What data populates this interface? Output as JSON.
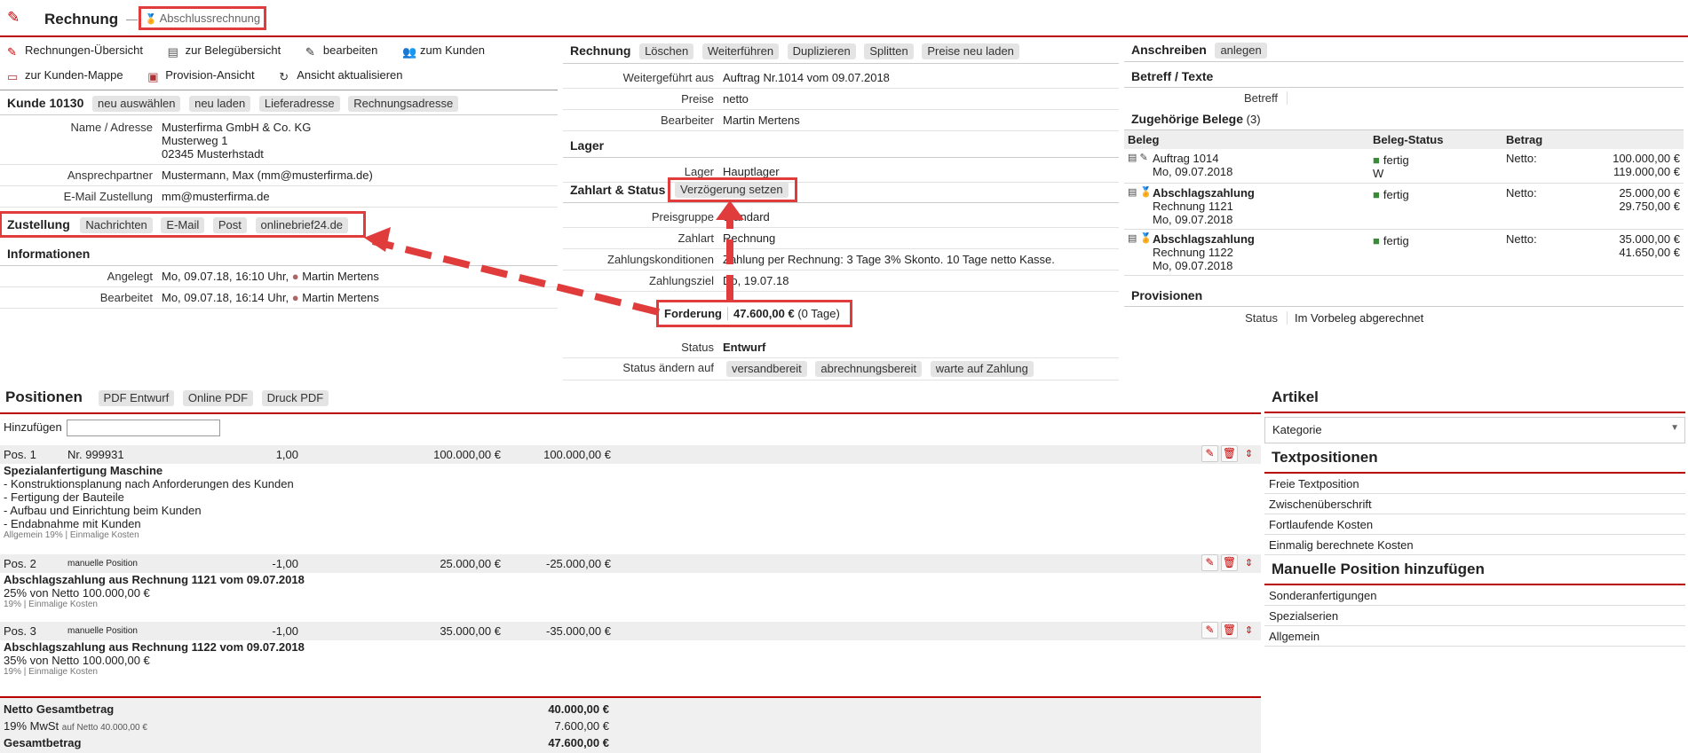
{
  "header": {
    "title": "Rechnung",
    "separator": "—",
    "badge": "Abschlussrechnung"
  },
  "toolbar": {
    "row1": [
      "Rechnungen-Übersicht",
      "zur Belegübersicht",
      "bearbeiten",
      "zum Kunden"
    ],
    "row2": [
      "zur Kunden-Mappe",
      "Provision-Ansicht",
      "Ansicht aktualisieren"
    ]
  },
  "customer": {
    "title": "Kunde 10130",
    "buttons": [
      "neu auswählen",
      "neu laden",
      "Lieferadresse",
      "Rechnungsadresse"
    ],
    "name_label": "Name / Adresse",
    "address": [
      "Musterfirma GmbH & Co. KG",
      "Musterweg 1",
      "02345 Musterhstadt"
    ],
    "contact_label": "Ansprechpartner",
    "contact": "Mustermann, Max (mm@musterfirma.de)",
    "email_label": "E-Mail Zustellung",
    "email": "mm@musterfirma.de"
  },
  "delivery": {
    "title": "Zustellung",
    "buttons": [
      "Nachrichten",
      "E-Mail",
      "Post",
      "onlinebrief24.de"
    ]
  },
  "info": {
    "title": "Informationen",
    "created_label": "Angelegt",
    "created": "Mo, 09.07.18, 16:10 Uhr,",
    "created_by": "Martin Mertens",
    "edited_label": "Bearbeitet",
    "edited": "Mo, 09.07.18, 16:14 Uhr,",
    "edited_by": "Martin Mertens"
  },
  "invoice": {
    "title": "Rechnung",
    "buttons": [
      "Löschen",
      "Weiterführen",
      "Duplizieren",
      "Splitten",
      "Preise neu laden"
    ],
    "from_label": "Weitergeführt aus",
    "from": "Auftrag Nr.1014 vom 09.07.2018",
    "prices_label": "Preise",
    "prices": "netto",
    "editor_label": "Bearbeiter",
    "editor": "Martin Mertens"
  },
  "stock": {
    "title": "Lager",
    "label": "Lager",
    "value": "Hauptlager"
  },
  "payment": {
    "title": "Zahlart & Status",
    "delay_button": "Verzögerung setzen",
    "group_label": "Preisgruppe",
    "group": "Standard",
    "method_label": "Zahlart",
    "method": "Rechnung",
    "terms_label": "Zahlungskonditionen",
    "terms": "Zahlung per Rechnung: 3 Tage 3% Skonto. 10 Tage netto Kasse.",
    "due_label": "Zahlungsziel",
    "due": "Do, 19.07.18",
    "claim_label": "Forderung",
    "claim_amount": "47.600,00 €",
    "claim_days": "(0 Tage)",
    "status_label": "Status",
    "status": "Entwurf",
    "change_label": "Status ändern auf",
    "change_buttons": [
      "versandbereit",
      "abrechnungsbereit",
      "warte auf Zahlung"
    ]
  },
  "letter": {
    "title": "Anschreiben",
    "button": "anlegen",
    "subject_title": "Betreff / Texte",
    "subject_value": "Betreff"
  },
  "related": {
    "title": "Zugehörige Belege",
    "count": "(3)",
    "headers": [
      "Beleg",
      "Beleg-Status",
      "Betrag"
    ],
    "rows": [
      {
        "line1": "Auftrag 1014",
        "line2": "Mo, 09.07.2018",
        "line3": "",
        "status": "fertig",
        "status2": "W",
        "netto": "Netto:",
        "v1": "100.000,00 €",
        "v2": "119.000,00 €"
      },
      {
        "line1": "Abschlagszahlung",
        "line2": "Rechnung 1121",
        "line3": "Mo, 09.07.2018",
        "status": "fertig",
        "status2": "",
        "netto": "Netto:",
        "v1": "25.000,00 €",
        "v2": "29.750,00 €"
      },
      {
        "line1": "Abschlagszahlung",
        "line2": "Rechnung 1122",
        "line3": "Mo, 09.07.2018",
        "status": "fertig",
        "status2": "",
        "netto": "Netto:",
        "v1": "35.000,00 €",
        "v2": "41.650,00 €"
      }
    ]
  },
  "commission": {
    "title": "Provisionen",
    "status_label": "Status",
    "status": "Im Vorbeleg abgerechnet"
  },
  "positions": {
    "title": "Positionen",
    "buttons": [
      "PDF Entwurf",
      "Online PDF",
      "Druck PDF"
    ],
    "add_label": "Hinzufügen",
    "items": [
      {
        "pos": "Pos. 1",
        "nr": "Nr. 999931",
        "qty": "1,00",
        "price": "100.000,00 €",
        "total": "100.000,00 €",
        "title": "Spezialanfertigung Maschine",
        "lines": [
          "- Konstruktionsplanung nach Anforderungen des Kunden",
          "- Fertigung der Bauteile",
          "- Aufbau und Einrichtung beim Kunden",
          "- Endabnahme mit Kunden"
        ],
        "meta": "Allgemein 19% | Einmalige Kosten"
      },
      {
        "pos": "Pos. 2",
        "nr": "manuelle Position",
        "qty": "-1,00",
        "price": "25.000,00 €",
        "total": "-25.000,00 €",
        "title": "Abschlagszahlung aus Rechnung 1121 vom 09.07.2018",
        "lines": [
          "25% von Netto 100.000,00 €"
        ],
        "meta": "19% | Einmalige Kosten"
      },
      {
        "pos": "Pos. 3",
        "nr": "manuelle Position",
        "qty": "-1,00",
        "price": "35.000,00 €",
        "total": "-35.000,00 €",
        "title": "Abschlagszahlung aus Rechnung 1122 vom 09.07.2018",
        "lines": [
          "35% von Netto 100.000,00 €"
        ],
        "meta": "19% | Einmalige Kosten"
      }
    ],
    "totals": {
      "net_label": "Netto Gesamtbetrag",
      "net": "40.000,00 €",
      "vat_label": "19% MwSt",
      "vat_note": "auf Netto 40.000,00 €",
      "vat": "7.600,00 €",
      "gross_label": "Gesamtbetrag",
      "gross": "47.600,00 €"
    }
  },
  "sidebar": {
    "article_title": "Artikel",
    "category_placeholder": "Kategorie",
    "text_title": "Textpositionen",
    "text_items": [
      "Freie Textposition",
      "Zwischenüberschrift",
      "Fortlaufende Kosten",
      "Einmalig berechnete Kosten"
    ],
    "manual_title": "Manuelle Position hinzufügen",
    "manual_items": [
      "Sonderanfertigungen",
      "Spezialserien",
      "Allgemein"
    ]
  },
  "colors": {
    "accent": "#b00000",
    "highlight": "#e03c3c",
    "folder": "#3a8a3a"
  }
}
